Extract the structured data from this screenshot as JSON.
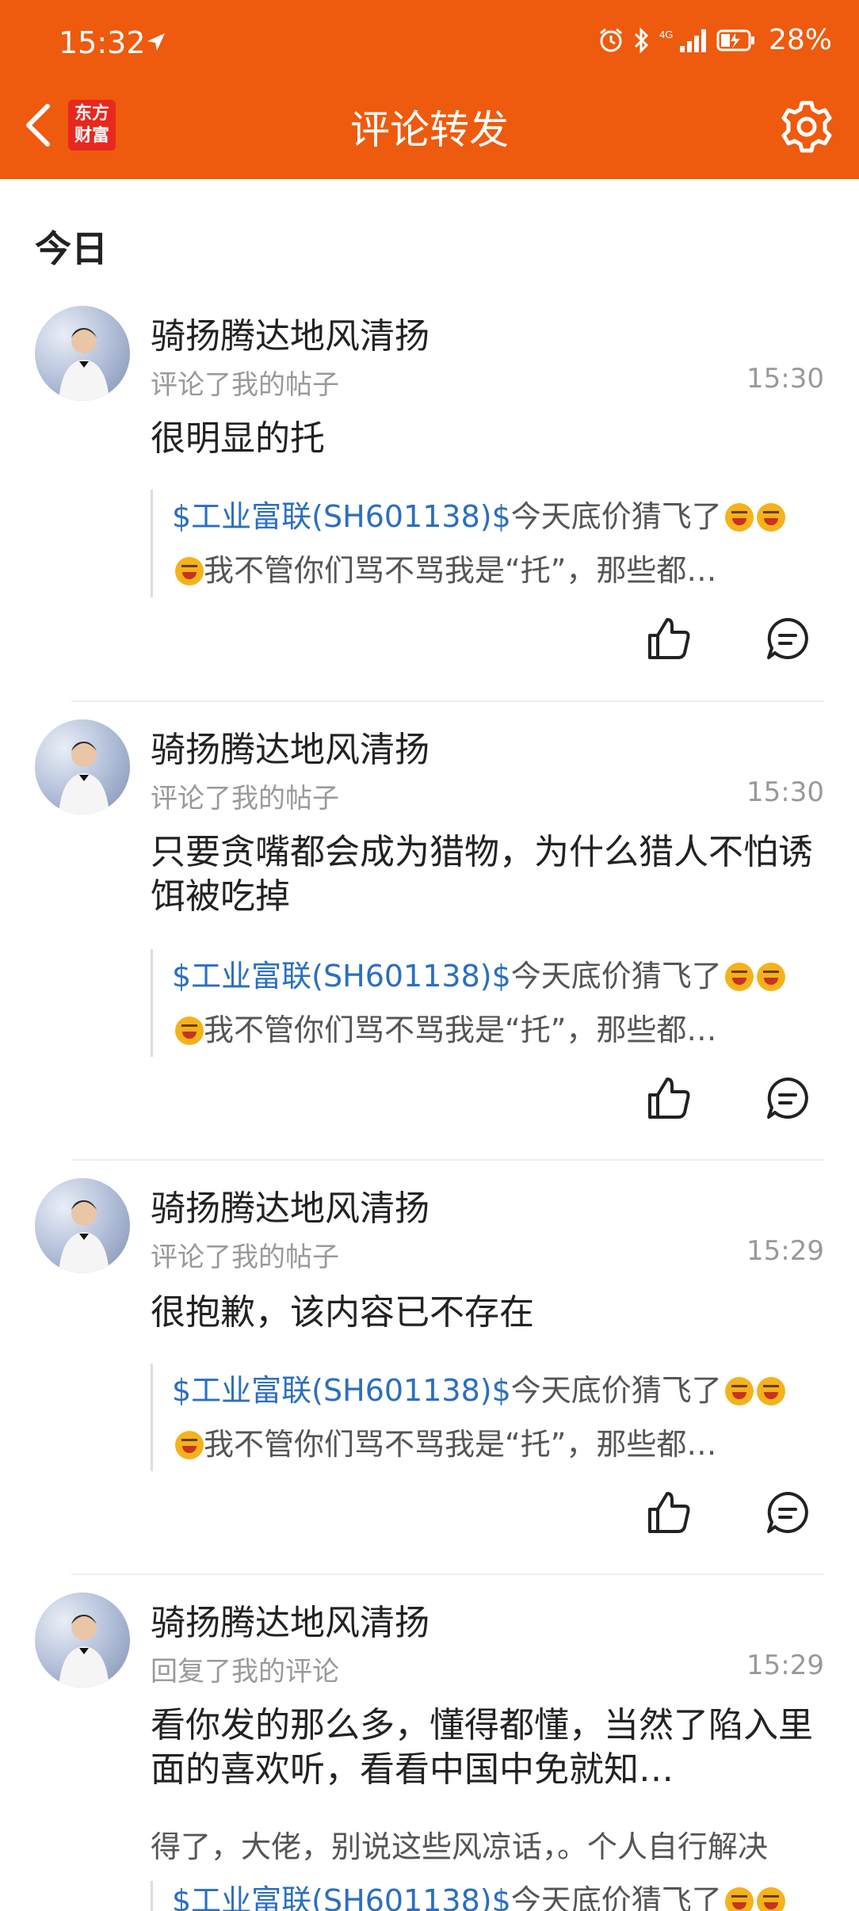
{
  "status_bar": {
    "time": "15:32",
    "battery": "28%",
    "network": "4G"
  },
  "header": {
    "title": "评论转发",
    "logo_line1": "东方",
    "logo_line2": "财富"
  },
  "section": {
    "title": "今日"
  },
  "items": [
    {
      "username": "骑扬腾达地风清扬",
      "action": "评论了我的帖子",
      "time": "15:30",
      "comment": "很明显的托",
      "quote_stock": "$工业富联(SH601138)$",
      "quote_text1": "今天底价猜飞了",
      "quote_text2": "我不管你们骂不骂我是“托”，那些都…"
    },
    {
      "username": "骑扬腾达地风清扬",
      "action": "评论了我的帖子",
      "time": "15:30",
      "comment": "只要贪嘴都会成为猎物，为什么猎人不怕诱饵被吃掉",
      "quote_stock": "$工业富联(SH601138)$",
      "quote_text1": "今天底价猜飞了",
      "quote_text2": "我不管你们骂不骂我是“托”，那些都…"
    },
    {
      "username": "骑扬腾达地风清扬",
      "action": "评论了我的帖子",
      "time": "15:29",
      "comment": " 很抱歉，该内容已不存在",
      "quote_stock": "$工业富联(SH601138)$",
      "quote_text1": "今天底价猜飞了",
      "quote_text2": "我不管你们骂不骂我是“托”，那些都…"
    },
    {
      "username": "骑扬腾达地风清扬",
      "action": "回复了我的评论",
      "time": "15:29",
      "comment": "看你发的那么多，懂得都懂，当然了陷入里面的喜欢听，看看中国中免就知…",
      "extra": "得了，大佬，别说这些风凉话，。个人自行解决",
      "quote_stock": "$工业富联(SH601138)$",
      "quote_text1": "今天底价猜飞了"
    }
  ],
  "colors": {
    "header": "#EE5A0E",
    "stock_link": "#2B6FBF",
    "muted": "#999999"
  }
}
